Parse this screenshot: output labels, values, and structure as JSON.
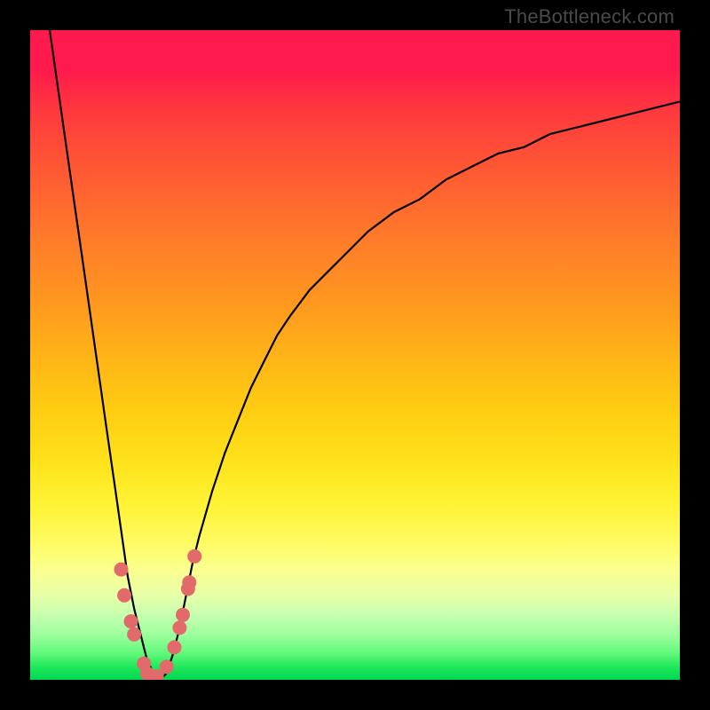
{
  "watermark": "TheBottleneck.com",
  "colors": {
    "frame": "#000000",
    "curve": "#000000",
    "marker_fill": "#e36a6a",
    "marker_stroke": "#b94848"
  },
  "chart_data": {
    "type": "line",
    "title": "",
    "xlabel": "",
    "ylabel": "",
    "xlim": [
      0,
      100
    ],
    "ylim": [
      0,
      100
    ],
    "x": [
      3,
      4,
      5,
      6,
      7,
      8,
      9,
      10,
      11,
      12,
      13,
      14,
      15,
      16,
      17,
      18,
      19,
      20,
      21,
      22,
      23,
      24,
      25,
      26,
      28,
      30,
      32,
      34,
      36,
      38,
      40,
      43,
      46,
      49,
      52,
      56,
      60,
      64,
      68,
      72,
      76,
      80,
      84,
      88,
      92,
      96,
      100
    ],
    "values": [
      100,
      93,
      86,
      79,
      72,
      65,
      58,
      51,
      44,
      37,
      30,
      23,
      16,
      11,
      7,
      3,
      1,
      0,
      1,
      4,
      8,
      13,
      18,
      22,
      29,
      35,
      40,
      45,
      49,
      53,
      56,
      60,
      63,
      66,
      69,
      72,
      74,
      77,
      79,
      81,
      82,
      84,
      85,
      86,
      87,
      88,
      89
    ],
    "markers": {
      "x": [
        14.0,
        14.5,
        15.5,
        16.0,
        17.5,
        18.0,
        19.0,
        19.5,
        21.0,
        22.2,
        23.0,
        23.5,
        24.3,
        24.5,
        25.3
      ],
      "y": [
        17,
        13,
        9,
        7,
        2.5,
        1,
        0.5,
        0.5,
        2,
        5,
        8,
        10,
        14,
        15,
        19
      ]
    },
    "note": "x and y are abstract 0–100 scales; y=0 is the bottom (green) edge. Values read off the curve by visual estimation."
  }
}
